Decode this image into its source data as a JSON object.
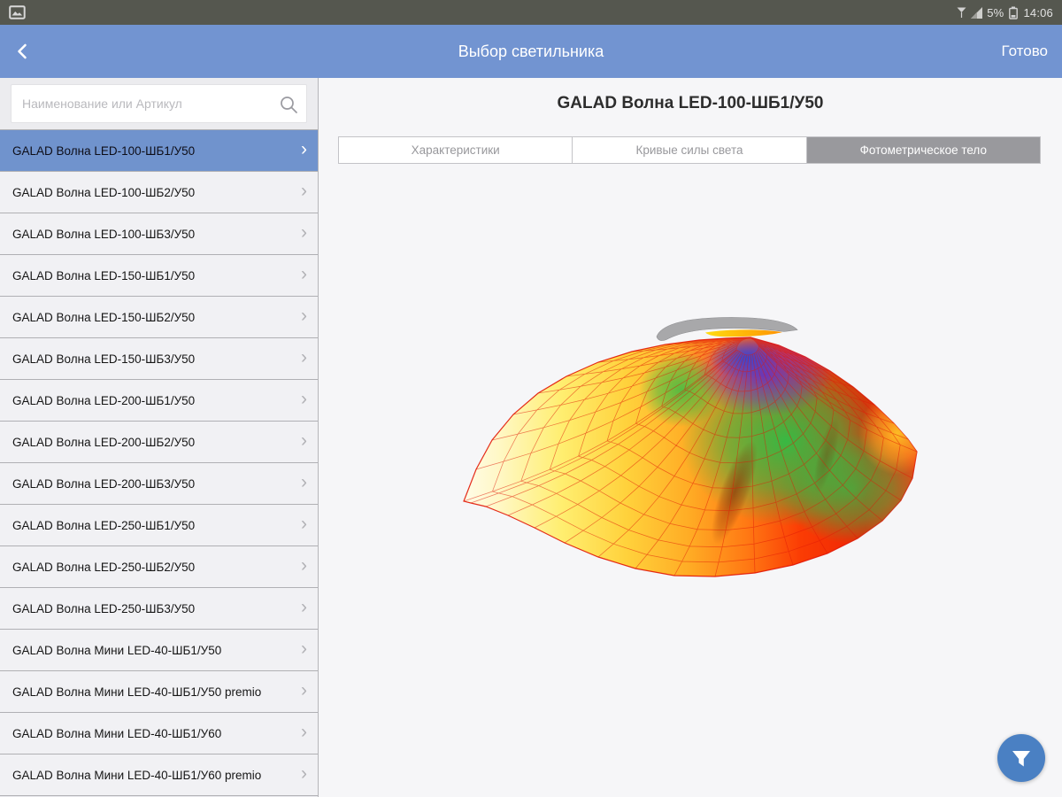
{
  "status_bar": {
    "time": "14:06",
    "battery": "5%"
  },
  "header": {
    "title": "Выбор светильника",
    "done_label": "Готово"
  },
  "sidebar": {
    "search_placeholder": "Наименование или Артикул",
    "items": [
      {
        "label": "GALAD Волна LED-100-ШБ1/У50",
        "selected": true
      },
      {
        "label": "GALAD Волна LED-100-ШБ2/У50",
        "selected": false
      },
      {
        "label": "GALAD Волна LED-100-ШБ3/У50",
        "selected": false
      },
      {
        "label": "GALAD Волна LED-150-ШБ1/У50",
        "selected": false
      },
      {
        "label": "GALAD Волна LED-150-ШБ2/У50",
        "selected": false
      },
      {
        "label": "GALAD Волна LED-150-ШБ3/У50",
        "selected": false
      },
      {
        "label": "GALAD Волна LED-200-ШБ1/У50",
        "selected": false
      },
      {
        "label": "GALAD Волна LED-200-ШБ2/У50",
        "selected": false
      },
      {
        "label": "GALAD Волна LED-200-ШБ3/У50",
        "selected": false
      },
      {
        "label": "GALAD Волна LED-250-ШБ1/У50",
        "selected": false
      },
      {
        "label": "GALAD Волна LED-250-ШБ2/У50",
        "selected": false
      },
      {
        "label": "GALAD Волна LED-250-ШБ3/У50",
        "selected": false
      },
      {
        "label": "GALAD Волна Мини LED-40-ШБ1/У50",
        "selected": false
      },
      {
        "label": "GALAD Волна Мини LED-40-ШБ1/У50 premio",
        "selected": false
      },
      {
        "label": "GALAD Волна Мини LED-40-ШБ1/У60",
        "selected": false
      },
      {
        "label": "GALAD Волна Мини LED-40-ШБ1/У60 premio",
        "selected": false
      }
    ]
  },
  "main": {
    "title": "GALAD Волна LED-100-ШБ1/У50",
    "tabs": [
      {
        "label": "Характеристики",
        "selected": false
      },
      {
        "label": "Кривые силы света",
        "selected": false
      },
      {
        "label": "Фотометрическое тело",
        "selected": true
      }
    ]
  },
  "colors": {
    "header_blue": "#7294d1",
    "selected_item_blue": "#7093cd",
    "fab_blue": "#4a80c3",
    "tab_selected_gray": "#99999d",
    "status_bar_gray": "#55574f"
  }
}
